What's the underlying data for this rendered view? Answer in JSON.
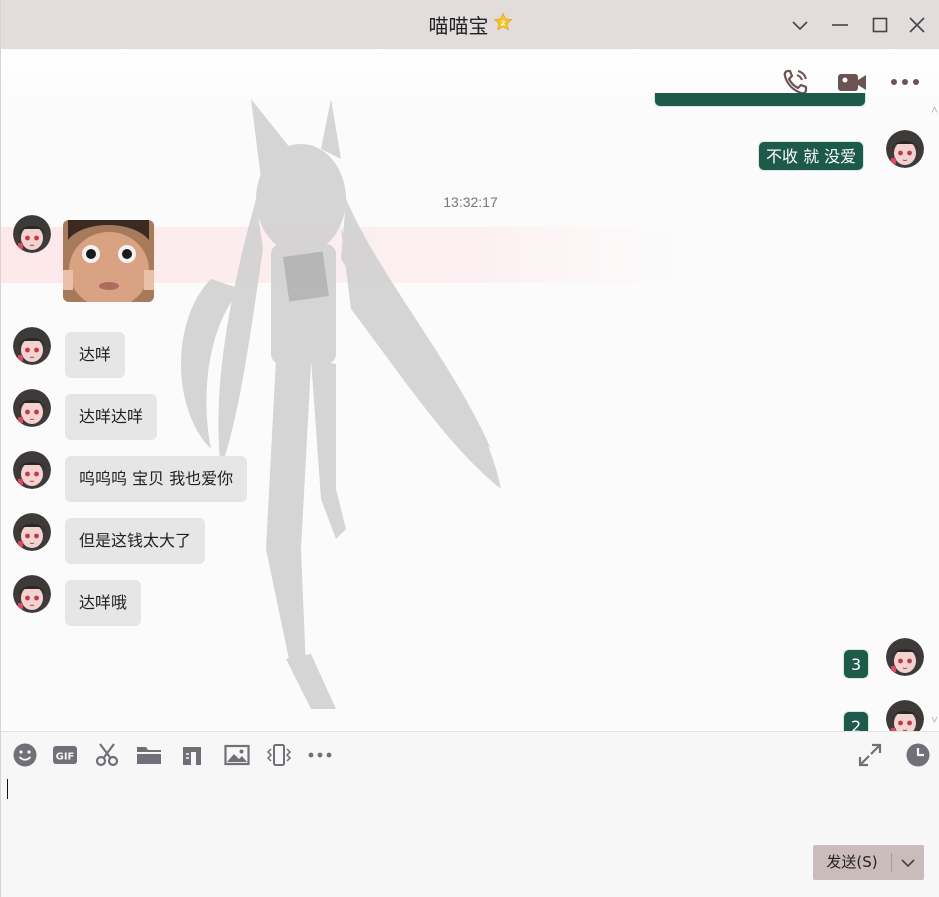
{
  "window": {
    "title": "喵喵宝",
    "accent": "#1d5a4a",
    "titlebar_color": "#e3dcdc"
  },
  "header_actions": {
    "voice_call_icon": "phone-icon",
    "video_call_icon": "video-camera-icon",
    "more_icon": "more-dots-icon"
  },
  "messages": {
    "out_1": "不收 就 没爱",
    "timestamp": "13:32:17",
    "in_image": "face-photo",
    "in_1": "达咩",
    "in_2": "达咩达咩",
    "in_3": "呜呜呜 宝贝 我也爱你",
    "in_4": "但是这钱太大了",
    "in_5": "达咩哦",
    "out_2": "3",
    "out_3": "2"
  },
  "toolbar": {
    "items": [
      "emoji-icon",
      "gif-icon",
      "scissors-icon",
      "folder-icon",
      "music-icon",
      "image-icon",
      "shake-icon",
      "more-dots-icon",
      "expand-icon",
      "history-clock-icon"
    ]
  },
  "composer": {
    "input_value": "",
    "send_label": "发送(S)"
  }
}
